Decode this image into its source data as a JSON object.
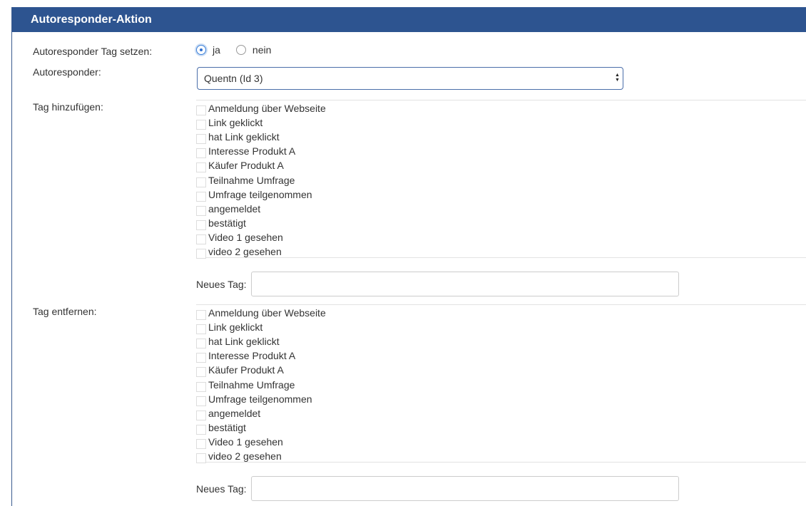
{
  "panel": {
    "title": "Autoresponder-Aktion"
  },
  "form": {
    "set_tag_label": "Autoresponder Tag setzen:",
    "radio_yes": "ja",
    "radio_no": "nein",
    "radio_selected": "ja",
    "autoresponder_label": "Autoresponder:",
    "autoresponder_value": "Quentn (Id 3)",
    "add_tag_label": "Tag hinzufügen:",
    "remove_tag_label": "Tag entfernen:",
    "new_tag_label": "Neues Tag:",
    "new_tag_value": "",
    "tags": [
      "Anmeldung über Webseite",
      "Link geklickt",
      "hat Link geklickt",
      "Interesse Produkt A",
      "Käufer Produkt A",
      "Teilnahme Umfrage",
      "Umfrage teilgenommen",
      "angemeldet",
      "bestätigt",
      "Video 1 gesehen",
      "video 2 gesehen"
    ]
  },
  "colors": {
    "header": "#2d5490",
    "accent": "#3b7fd8"
  },
  "icons": {
    "select_arrows": "up-down-arrows-icon"
  }
}
